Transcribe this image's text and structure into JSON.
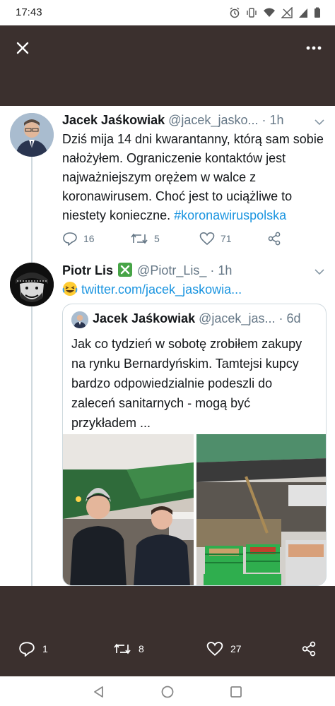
{
  "status_bar": {
    "time": "17:43"
  },
  "main_tweet": {
    "author_name": "Jacek Jaśkowiak",
    "author_handle": "@jacek_jasko...",
    "time_ago": "· 1h",
    "text": "Dziś mija 14 dni kwarantanny, którą sam sobie nałożyłem. Ograniczenie kontaktów jest najważniejszym orężem w walce z koronawirusem. Choć jest to uciążliwe to niestety konieczne. ",
    "hashtag": "#koronawiruspolska",
    "replies": "16",
    "retweets": "5",
    "likes": "71"
  },
  "reply_tweet": {
    "author_name": "Piotr Lis",
    "author_handle": "@Piotr_Lis_",
    "time_ago": "· 1h",
    "link": "twitter.com/jacek_jaskowia...",
    "replies": "1",
    "retweets": "8",
    "likes": "27"
  },
  "quoted_tweet": {
    "author_name": "Jacek Jaśkowiak",
    "author_handle": "@jacek_jas...",
    "time_ago": "· 6d",
    "text": "Jak co tydzień w sobotę zrobiłem zakupy na rynku Bernardyńskim. Tamtejsi kupcy bardzo odpowiedzialnie podeszli do zaleceń sanitarnych - mogą być przykładem ..."
  },
  "colors": {
    "accent": "#1b95e0",
    "background_dark": "#3b302e",
    "secondary_text": "#657786"
  }
}
